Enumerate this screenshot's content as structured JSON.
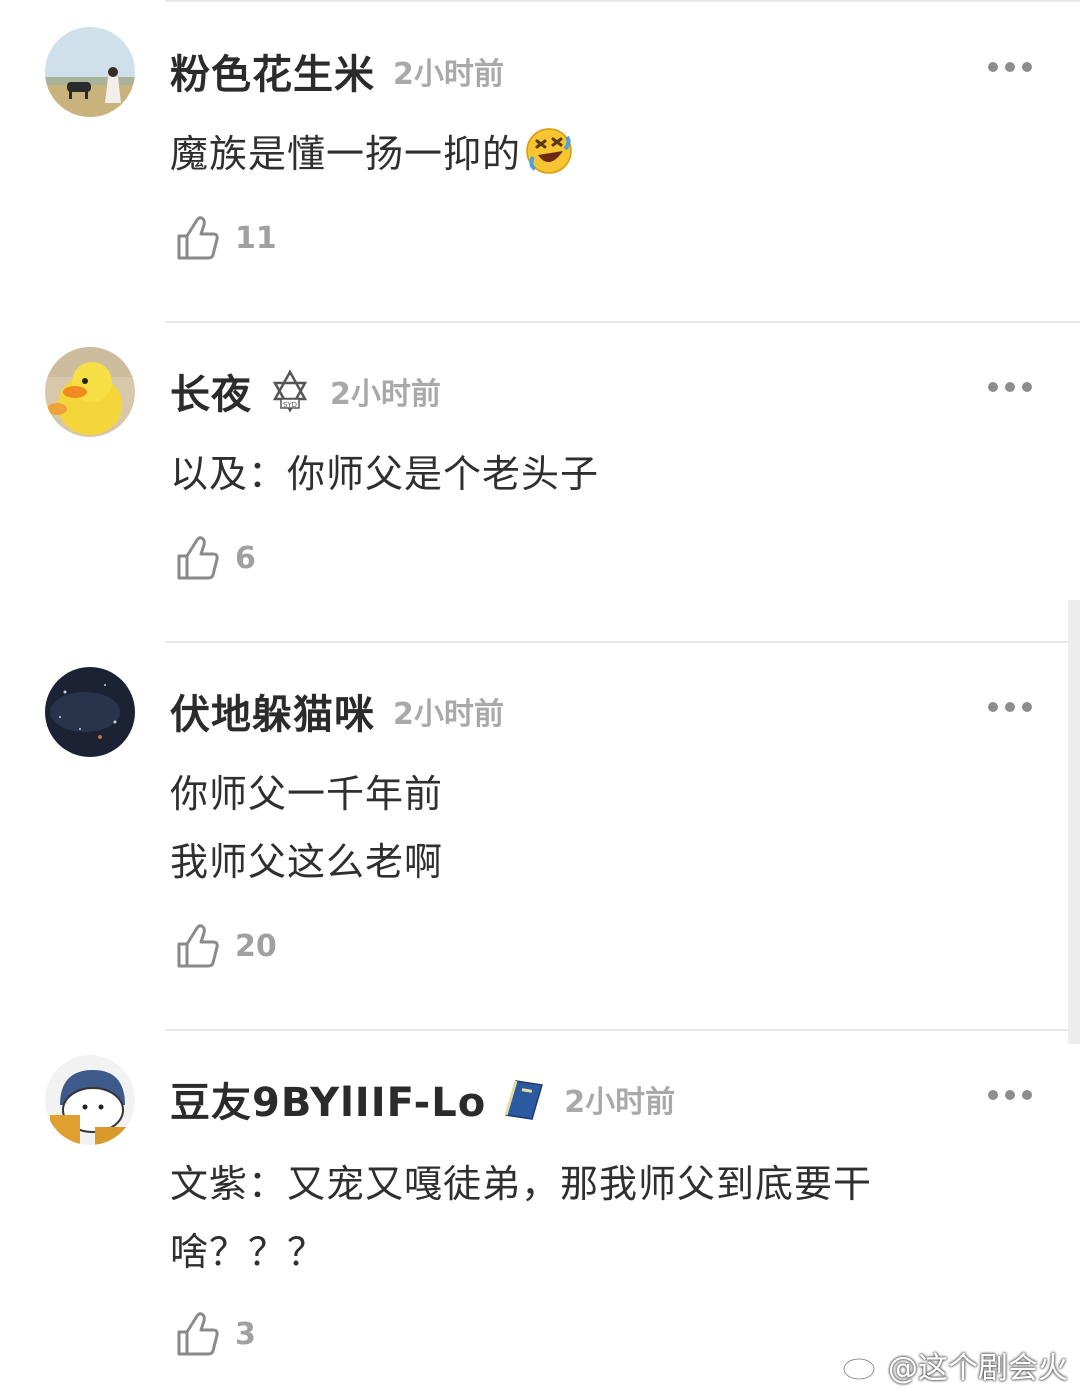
{
  "comments": [
    {
      "username": "粉色花生米",
      "time": "2小时前",
      "text_lines": [
        "魔族是懂一扬一抑的"
      ],
      "emoji": "rofl-emoji",
      "likes": "11"
    },
    {
      "username": "长夜",
      "badge": "star-badge-icon",
      "time": "2小时前",
      "text_lines": [
        "以及：你师父是个老头子"
      ],
      "likes": "6"
    },
    {
      "username": "伏地躲猫咪",
      "time": "2小时前",
      "text_lines": [
        "你师父一千年前",
        "我师父这么老啊"
      ],
      "likes": "20"
    },
    {
      "username": "豆友9BYlIIF-Lo",
      "badge": "book-badge-icon",
      "time": "2小时前",
      "text_lines": [
        "文紫：又宠又嘎徒弟，那我师父到底要干",
        "啥？？？"
      ],
      "likes": "3"
    }
  ],
  "watermark": {
    "text": "@这个剧会火",
    "icon": "weibo-icon"
  },
  "colors": {
    "text": "#2f2f2f",
    "meta": "#a9a9a9",
    "divider": "#e8e8e8"
  }
}
